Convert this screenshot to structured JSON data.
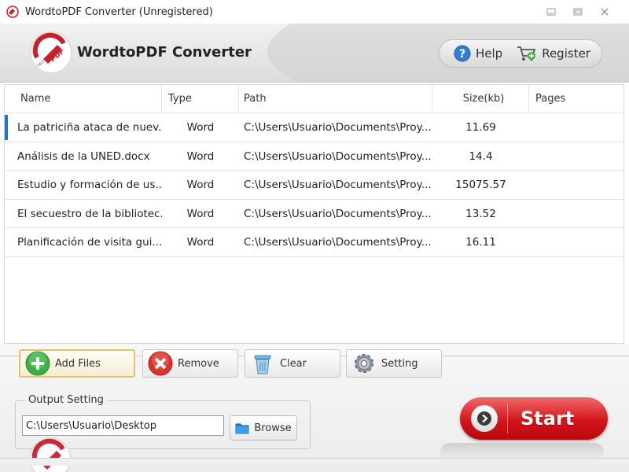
{
  "window": {
    "title": "WordtoPDF Converter (Unregistered)",
    "controls": {
      "minimize": "minimize-icon",
      "maximize": "maximize-icon",
      "close": "close-icon"
    }
  },
  "header": {
    "app_title": "WordtoPDF Converter",
    "logo_text": "PDF",
    "logo_small_text": "Word",
    "help_label": "Help",
    "register_label": "Register"
  },
  "table": {
    "columns": [
      "Name",
      "Type",
      "Path",
      "Size(kb)",
      "Pages"
    ],
    "rows": [
      {
        "name": "La patriciña ataca de nuev...",
        "type": "Word",
        "path": "C:\\Users\\Usuario\\Documents\\Proy...",
        "size": "11.69",
        "pages": ""
      },
      {
        "name": "Análisis de la UNED.docx",
        "type": "Word",
        "path": "C:\\Users\\Usuario\\Documents\\Proy...",
        "size": "14.4",
        "pages": ""
      },
      {
        "name": "Estudio y formación de us...",
        "type": "Word",
        "path": "C:\\Users\\Usuario\\Documents\\Proy...",
        "size": "15075.57",
        "pages": ""
      },
      {
        "name": "El secuestro de la bibliotec...",
        "type": "Word",
        "path": "C:\\Users\\Usuario\\Documents\\Proy...",
        "size": "13.52",
        "pages": ""
      },
      {
        "name": "Planificación de visita gui...",
        "type": "Word",
        "path": "C:\\Users\\Usuario\\Documents\\Proy...",
        "size": "16.11",
        "pages": ""
      }
    ]
  },
  "actions": {
    "add_files": "Add Files",
    "remove": "Remove",
    "clear": "Clear",
    "setting": "Setting"
  },
  "output": {
    "legend": "Output Setting",
    "path_value": "C:\\Users\\Usuario\\Desktop",
    "browse_label": "Browse"
  },
  "start": {
    "label": "Start"
  },
  "colors": {
    "start_red": "#d4141c",
    "selection_blue": "#1e72c8",
    "add_green": "#3cb043",
    "remove_red": "#d9342b"
  }
}
